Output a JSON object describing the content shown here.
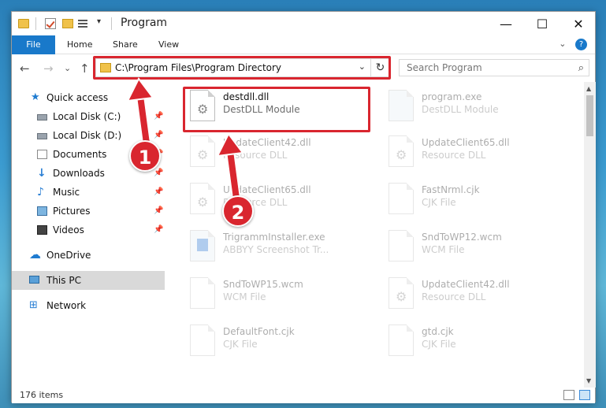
{
  "window": {
    "title": "Program",
    "controls": {
      "minimize": "—",
      "maximize": "☐",
      "close": "✕"
    }
  },
  "ribbon": {
    "tabs": [
      "File",
      "Home",
      "Share",
      "View"
    ],
    "collapse_icon": "⌄",
    "help": "?"
  },
  "nav": {
    "back": "←",
    "forward": "→",
    "recent": "⌄",
    "up": "↑",
    "address": "C:\\Program Files\\Program Directory",
    "address_chevron": "⌄",
    "refresh": "↻",
    "search_placeholder": "Search Program",
    "search_icon": "⌕"
  },
  "sidebar": {
    "items": [
      {
        "label": "Quick access",
        "icon": "quick-access-star-icon",
        "pinned": false
      },
      {
        "label": "Local Disk (C:)",
        "icon": "disk-icon",
        "pinned": true
      },
      {
        "label": "Local Disk (D:)",
        "icon": "disk-icon",
        "pinned": true
      },
      {
        "label": "Documents",
        "icon": "documents-icon",
        "pinned": true
      },
      {
        "label": "Downloads",
        "icon": "downloads-icon",
        "pinned": true
      },
      {
        "label": "Music",
        "icon": "music-icon",
        "pinned": true
      },
      {
        "label": "Pictures",
        "icon": "pictures-icon",
        "pinned": true
      },
      {
        "label": "Videos",
        "icon": "videos-icon",
        "pinned": true
      },
      {
        "label": "OneDrive",
        "icon": "onedrive-icon",
        "pinned": false
      },
      {
        "label": "This PC",
        "icon": "this-pc-icon",
        "pinned": false,
        "selected": true
      },
      {
        "label": "Network",
        "icon": "network-icon",
        "pinned": false
      }
    ],
    "pin_glyph": "📌"
  },
  "files": [
    {
      "name": "destdll.dll",
      "type": "DestDLL Module",
      "highlighted": true
    },
    {
      "name": "program.exe",
      "type": "DestDLL Module"
    },
    {
      "name": "UpdateClient42.dll",
      "type": "Resource DLL"
    },
    {
      "name": "UpdateClient65.dll",
      "type": "Resource DLL"
    },
    {
      "name": "UpdateClient65.dll",
      "type": "Resource DLL"
    },
    {
      "name": "FastNrml.cjk",
      "type": "CJK File"
    },
    {
      "name": "TrigrammInstaller.exe",
      "type": "ABBYY Screenshot Tr..."
    },
    {
      "name": "SndToWP12.wcm",
      "type": "WCM File"
    },
    {
      "name": "SndToWP15.wcm",
      "type": "WCM File"
    },
    {
      "name": "UpdateClient42.dll",
      "type": "Resource DLL"
    },
    {
      "name": "DefaultFont.cjk",
      "type": "CJK File"
    },
    {
      "name": "gtd.cjk",
      "type": "CJK File"
    }
  ],
  "status": {
    "item_count": "176 items"
  },
  "annotations": {
    "step1": "1",
    "step2": "2"
  },
  "colors": {
    "accent": "#1979ca",
    "highlight": "#d9262f"
  }
}
